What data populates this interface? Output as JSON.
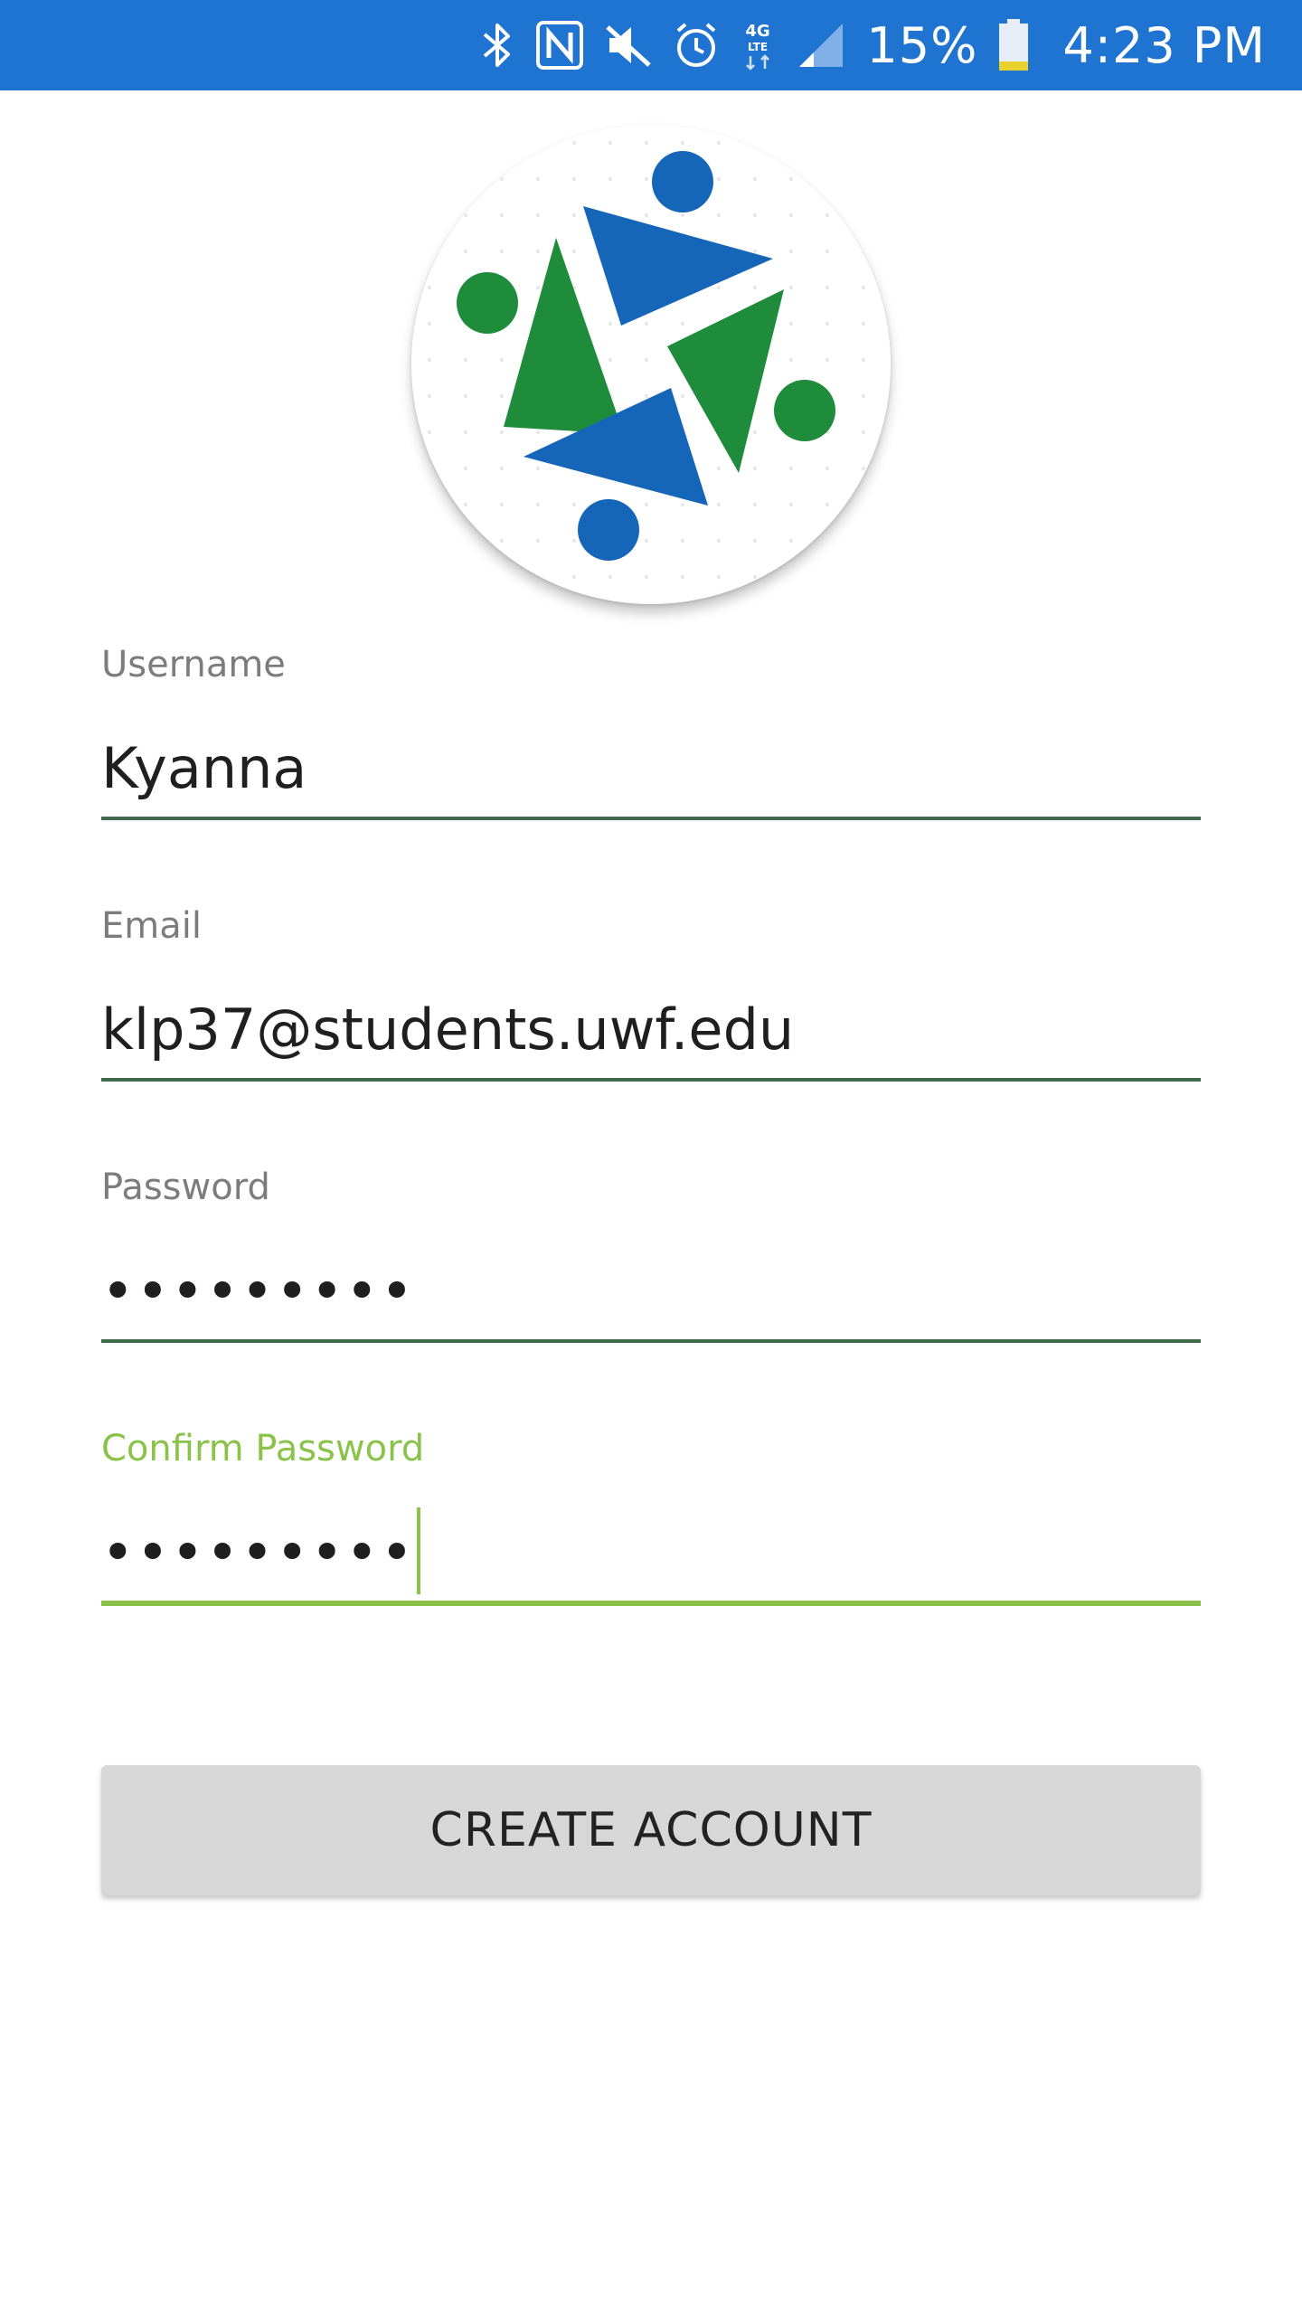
{
  "status_bar": {
    "icons": [
      "bluetooth-icon",
      "nfc-icon",
      "mute-icon",
      "alarm-icon",
      "4g-lte-icon",
      "signal-icon",
      "battery-icon"
    ],
    "network_label": "4G LTE",
    "battery_percent": "15%",
    "time": "4:23 PM",
    "bar_color": "#1f73d1"
  },
  "logo": {
    "name": "app-logo",
    "colors": {
      "blue": "#1565b8",
      "green": "#1e8c3a"
    }
  },
  "form": {
    "username": {
      "label": "Username",
      "value": "Kyanna"
    },
    "email": {
      "label": "Email",
      "value": "klp37@students.uwf.edu"
    },
    "password": {
      "label": "Password",
      "value": "•••••••••"
    },
    "confirm_password": {
      "label": "Confirm Password",
      "value": "•••••••••"
    }
  },
  "create_button": {
    "label": "CREATE ACCOUNT"
  },
  "accent_color": "#8bc34a"
}
